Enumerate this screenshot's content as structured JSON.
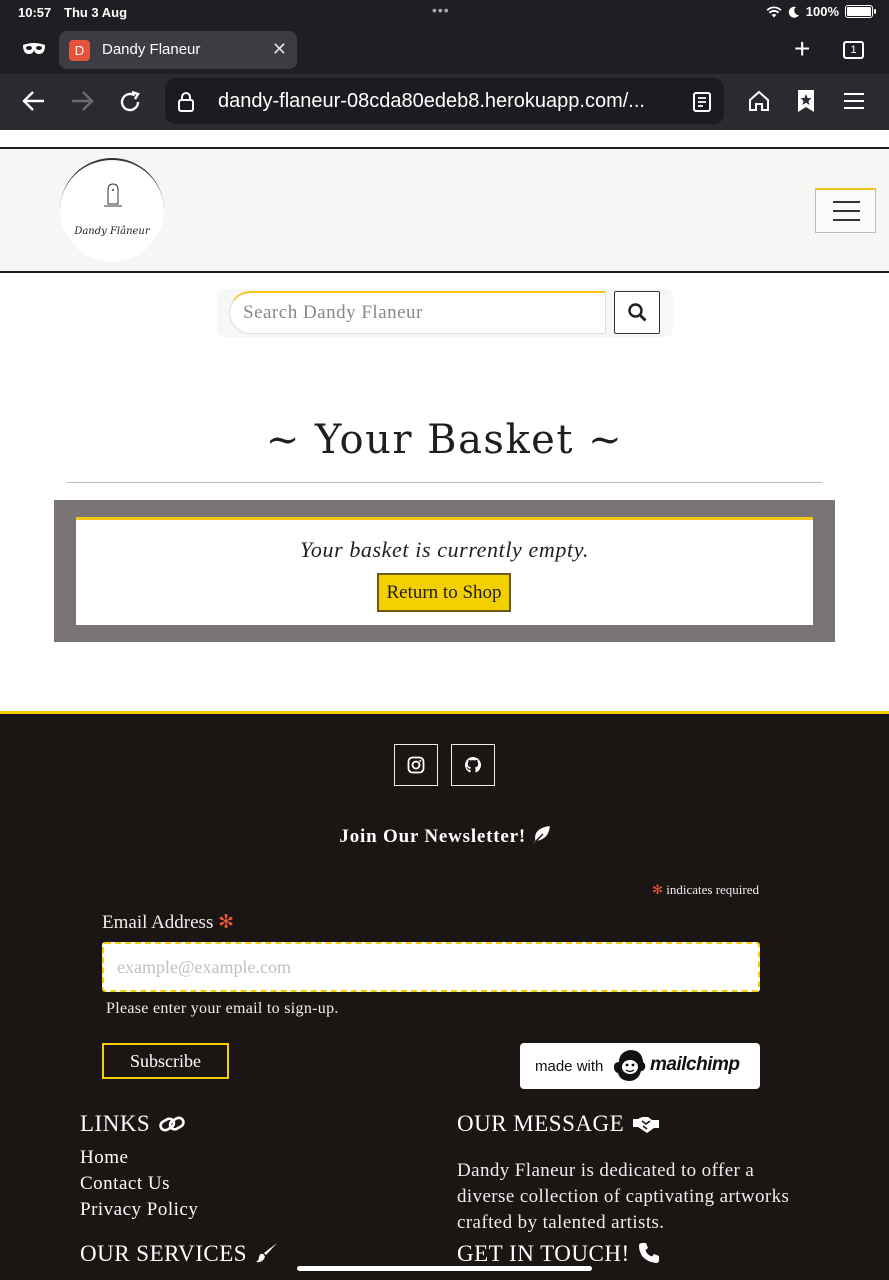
{
  "status_bar": {
    "time": "10:57",
    "date": "Thu 3 Aug",
    "battery": "100%"
  },
  "browser": {
    "tab_title": "Dandy Flaneur",
    "tab_favicon_letter": "D",
    "tab_count": "1",
    "url": "dandy-flaneur-08cda80edeb8.herokuapp.com/..."
  },
  "header": {
    "logo_text": "Dandy Flâneur"
  },
  "search": {
    "placeholder": "Search Dandy Flaneur"
  },
  "basket": {
    "title": "~ Your Basket ~",
    "empty_message": "Your basket is currently empty.",
    "return_button": "Return to Shop"
  },
  "footer": {
    "newsletter_title": "Join Our Newsletter!",
    "required_symbol": "✻",
    "required_note": "indicates required",
    "email_label": "Email Address",
    "email_placeholder": "example@example.com",
    "email_help": "Please enter your email to sign-up.",
    "subscribe_button": "Subscribe",
    "mailchimp_made_with": "made with",
    "mailchimp_word": "mailchimp",
    "links_heading": "LINKS",
    "links": [
      "Home",
      "Contact Us",
      "Privacy Policy"
    ],
    "message_heading": "OUR MESSAGE",
    "message_text": "Dandy Flaneur is dedicated to offer a diverse collection of captivating artworks crafted by talented artists.",
    "services_heading": "OUR SERVICES",
    "contact_heading": "GET IN TOUCH!"
  },
  "colors": {
    "accent": "#f5d000",
    "footer_bg": "#1b1514",
    "basket_frame": "#7a7574",
    "required": "#e9563c"
  }
}
